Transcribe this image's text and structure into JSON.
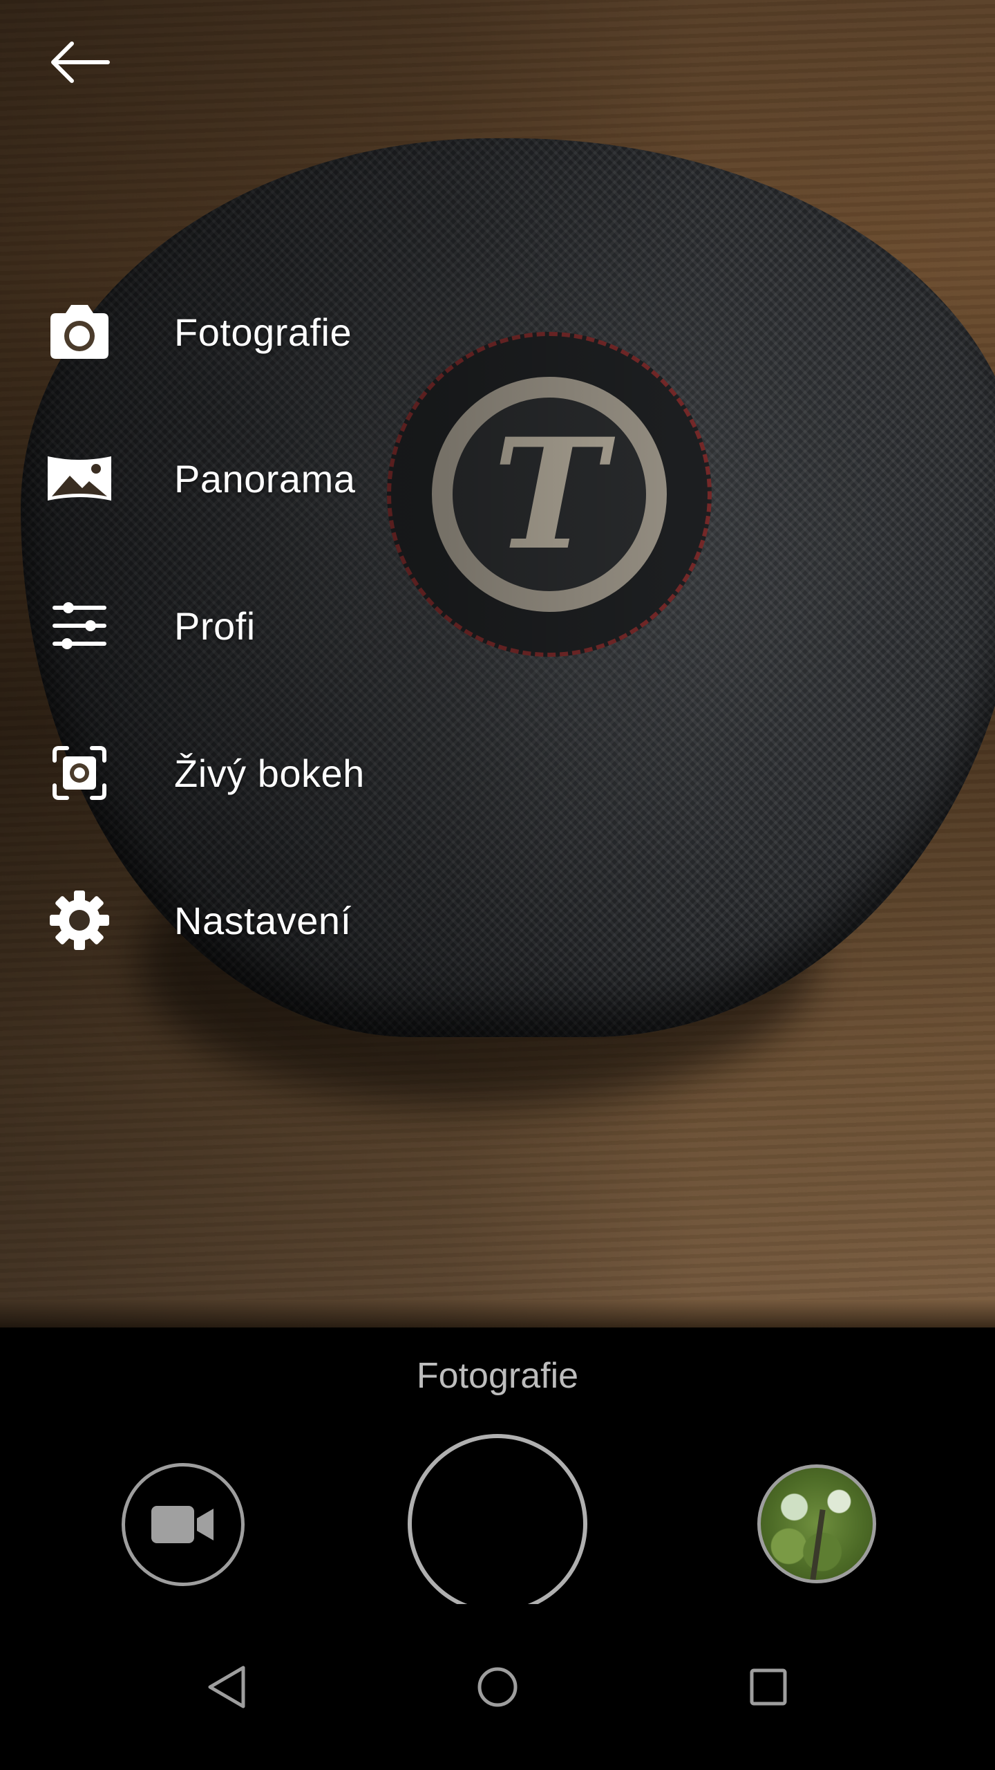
{
  "app": {
    "accent": "#ffffff",
    "background": "#000000"
  },
  "top_bar": {
    "back_icon": "arrow-left-icon"
  },
  "menu": {
    "items": [
      {
        "id": "photo",
        "label": "Fotografie",
        "icon": "camera-icon"
      },
      {
        "id": "panorama",
        "label": "Panorama",
        "icon": "landscape-icon"
      },
      {
        "id": "pro",
        "label": "Profi",
        "icon": "sliders-icon"
      },
      {
        "id": "bokeh",
        "label": "Živý bokeh",
        "icon": "bokeh-icon"
      },
      {
        "id": "settings",
        "label": "Nastavení",
        "icon": "gear-icon"
      }
    ]
  },
  "controls": {
    "mode_label": "Fotografie",
    "video_icon": "video-camera-icon",
    "shutter_icon": "shutter-icon",
    "gallery_icon": "gallery-thumbnail"
  },
  "navbar": {
    "back_icon": "nav-back-icon",
    "home_icon": "nav-home-icon",
    "recents_icon": "nav-recents-icon"
  }
}
